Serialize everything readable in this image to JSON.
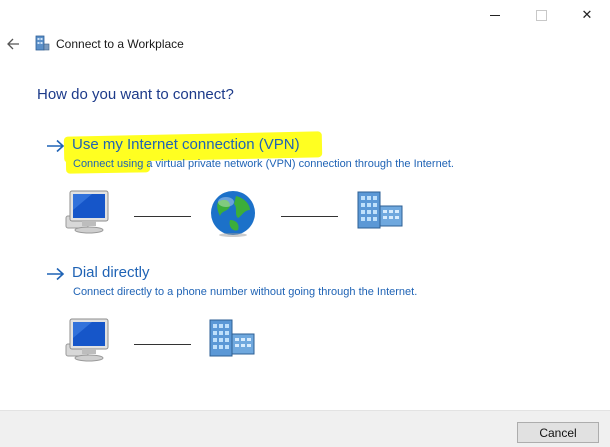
{
  "window": {
    "minimize_icon": "minimize-icon",
    "maximize_icon": "maximize-icon",
    "close_icon": "close-icon",
    "close_glyph": "✕"
  },
  "header": {
    "title": "Connect to a Workplace",
    "back_icon": "back-arrow-icon",
    "app_icon": "workplace-icon"
  },
  "main": {
    "question": "How do you want to connect?",
    "options": [
      {
        "title": "Use my Internet connection (VPN)",
        "description": "Connect using a virtual private network (VPN) connection through the Internet.",
        "highlighted": true
      },
      {
        "title": "Dial directly",
        "description": "Connect directly to a phone number without going through the Internet.",
        "highlighted": false
      }
    ]
  },
  "footer": {
    "cancel_label": "Cancel"
  },
  "colors": {
    "link_blue": "#1f63b5",
    "heading_blue": "#1c3a8a",
    "highlight": "#ffff21",
    "footer_bg": "#f0f0f0"
  }
}
